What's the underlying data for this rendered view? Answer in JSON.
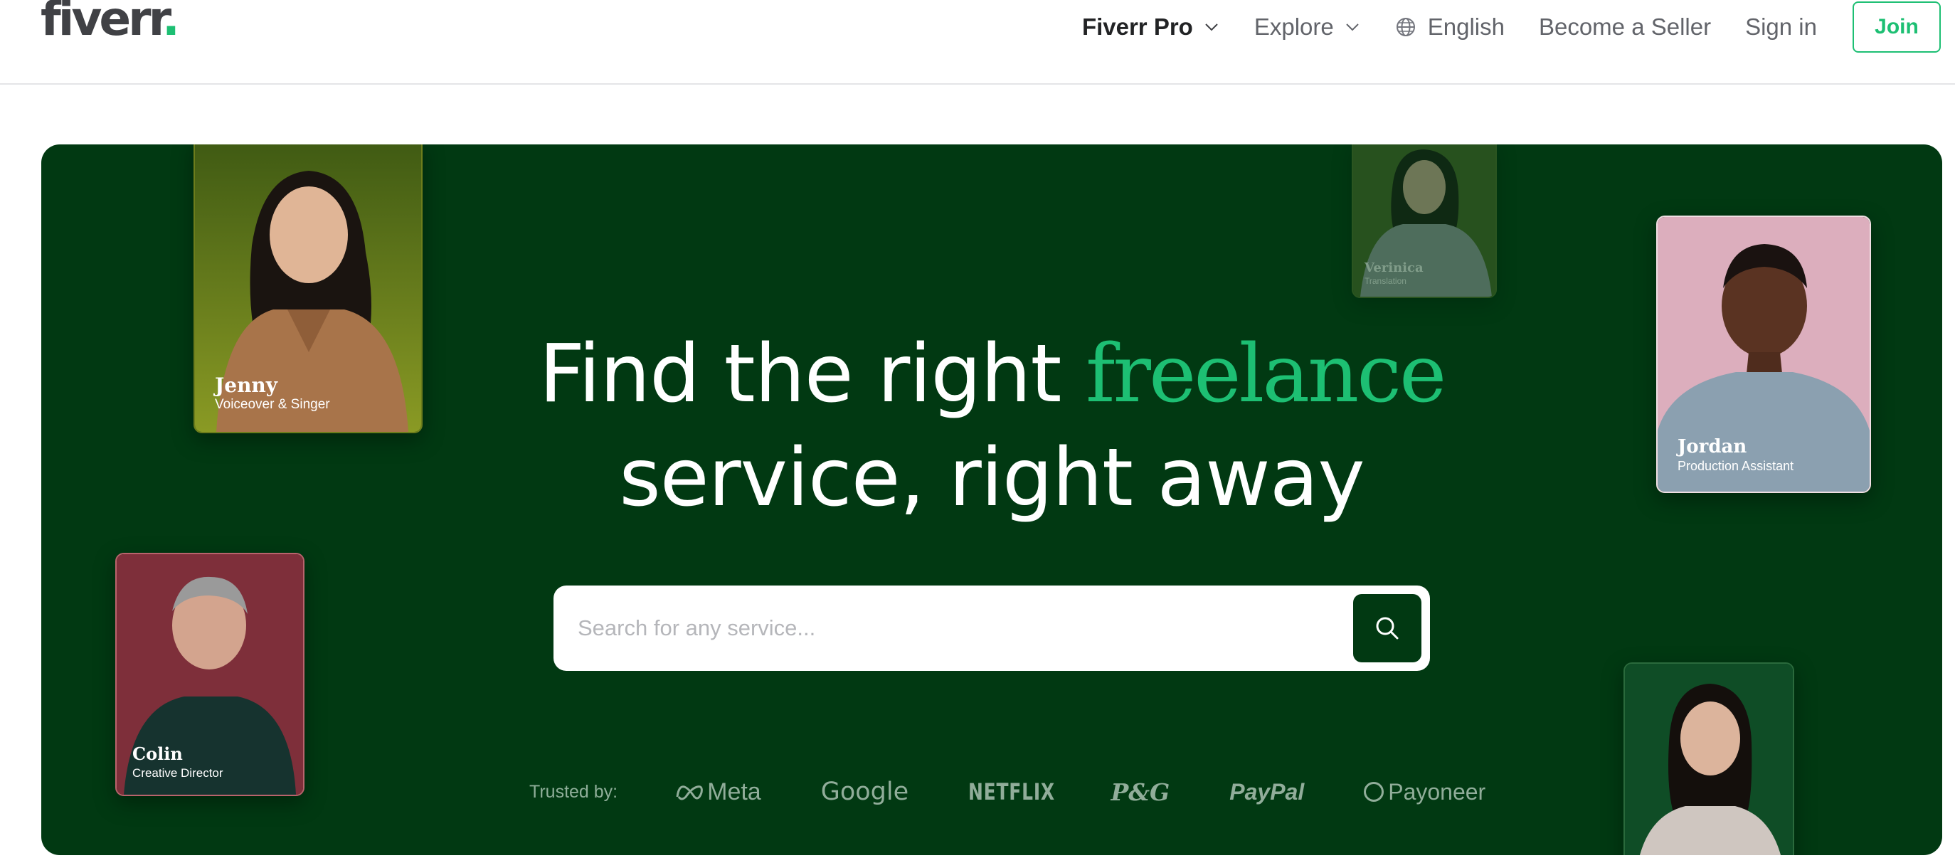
{
  "header": {
    "logo_text": "fiverr",
    "logo_dot": ".",
    "nav": {
      "fiverr_pro": "Fiverr Pro",
      "explore": "Explore",
      "language": "English",
      "become_seller": "Become a Seller",
      "sign_in": "Sign in",
      "join": "Join"
    }
  },
  "hero": {
    "headline_part1": "Find the right",
    "headline_accent": "freelance",
    "headline_part2": "service, right away",
    "search_placeholder": "Search for any service...",
    "trusted_label": "Trusted by:",
    "brands": [
      "Meta",
      "Google",
      "NETFLIX",
      "P&G",
      "PayPal",
      "Payoneer"
    ],
    "freelancers": [
      {
        "name": "Jenny",
        "role": "Voiceover & Singer"
      },
      {
        "name": "Colin",
        "role": "Creative Director"
      },
      {
        "name": "Verinica",
        "role": "Translation"
      },
      {
        "name": "Jordan",
        "role": "Production Assistant"
      }
    ]
  },
  "colors": {
    "brand_green": "#1dbf73",
    "hero_background": "#013912",
    "text_dark": "#404145"
  }
}
